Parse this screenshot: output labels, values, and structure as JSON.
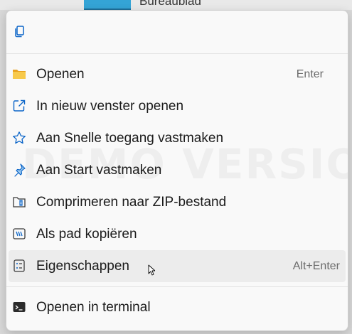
{
  "backdrop": {
    "text": "Bureaublad"
  },
  "toolbar": {
    "copy_icon": "copy-icon"
  },
  "menu": {
    "items": [
      {
        "label": "Openen",
        "shortcut": "Enter",
        "icon": "folder-icon"
      },
      {
        "label": "In nieuw venster openen",
        "shortcut": "",
        "icon": "open-external-icon"
      },
      {
        "label": "Aan Snelle toegang vastmaken",
        "shortcut": "",
        "icon": "star-icon"
      },
      {
        "label": "Aan Start vastmaken",
        "shortcut": "",
        "icon": "pin-icon"
      },
      {
        "label": "Comprimeren naar ZIP-bestand",
        "shortcut": "",
        "icon": "zip-icon"
      },
      {
        "label": "Als pad kopiëren",
        "shortcut": "",
        "icon": "copy-path-icon"
      },
      {
        "label": "Eigenschappen",
        "shortcut": "Alt+Enter",
        "icon": "properties-icon"
      },
      {
        "label": "Openen in terminal",
        "shortcut": "",
        "icon": "terminal-icon"
      }
    ]
  },
  "watermark": "DEMO VERSION",
  "colors": {
    "accent": "#0a64c8",
    "folder": "#f4b73e",
    "menu_bg": "#f9f9f9",
    "hover_bg": "#ececec"
  }
}
